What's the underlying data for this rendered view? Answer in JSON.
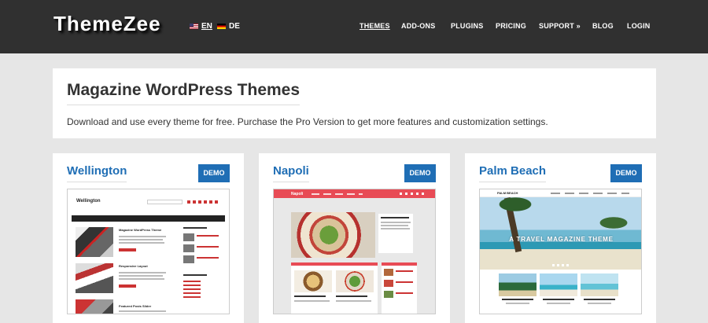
{
  "header": {
    "logo": "ThemeZee",
    "languages": [
      {
        "code": "EN",
        "flag": "us-flag-icon"
      },
      {
        "code": "DE",
        "flag": "de-flag-icon"
      }
    ],
    "nav": [
      "THEMES",
      "ADD-ONS",
      "PLUGINS",
      "PRICING",
      "SUPPORT »",
      "BLOG",
      "LOGIN"
    ]
  },
  "intro": {
    "title": "Magazine WordPress Themes",
    "text": "Download and use every theme for free. Purchase the Pro Version to get more features and customization settings."
  },
  "themes": [
    {
      "name": "Wellington",
      "demo_label": "DEMO",
      "preview": {
        "site_title": "Wellington",
        "posts": [
          "Magazine WordPress Theme",
          "Responsive Layout",
          "Featured Posts Slider"
        ]
      }
    },
    {
      "name": "Napoli",
      "demo_label": "DEMO",
      "preview": {
        "site_title": "Napoli"
      }
    },
    {
      "name": "Palm Beach",
      "demo_label": "DEMO",
      "preview": {
        "site_title": "PALM BEACH",
        "hero_title": "A TRAVEL MAGAZINE THEME"
      }
    }
  ],
  "colors": {
    "header_bg": "#303030",
    "page_bg": "#e6e6e6",
    "accent": "#1f6eb5",
    "napoli_red": "#e84b55"
  }
}
